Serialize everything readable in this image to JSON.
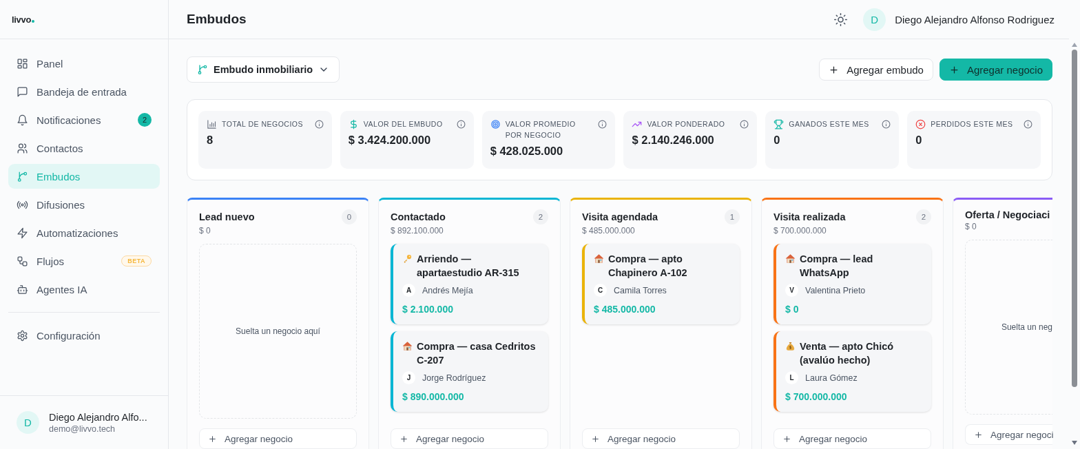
{
  "sidebar": {
    "logo": "livvo",
    "items": [
      {
        "label": "Panel",
        "selected": false
      },
      {
        "label": "Bandeja de entrada",
        "selected": false
      },
      {
        "label": "Notificaciones",
        "selected": false,
        "badge": {
          "text": "2",
          "kind": "count"
        }
      },
      {
        "label": "Contactos",
        "selected": false
      },
      {
        "label": "Embudos",
        "selected": true
      },
      {
        "label": "Difusiones",
        "selected": false
      },
      {
        "label": "Automatizaciones",
        "selected": false
      },
      {
        "label": "Flujos",
        "selected": false,
        "badge": {
          "text": "BETA",
          "kind": "beta"
        }
      },
      {
        "label": "Agentes IA",
        "selected": false
      }
    ],
    "settings": {
      "label": "Configuración",
      "selected": false
    },
    "user": {
      "initial": "D",
      "name": "Diego Alejandro Alfo...",
      "email": "demo@livvo.tech"
    }
  },
  "header": {
    "title": "Embudos",
    "user": {
      "initial": "D",
      "name": "Diego Alejandro Alfonso Rodriguez"
    }
  },
  "toolbar": {
    "pipeline": "Embudo inmobiliario",
    "buttons": [
      {
        "label": "Agregar embudo",
        "kind": "secondary"
      },
      {
        "label": "Agregar negocio",
        "kind": "primary"
      }
    ]
  },
  "stats": [
    {
      "label": "TOTAL DE NEGOCIOS",
      "value": "8"
    },
    {
      "label": "VALOR DEL EMBUDO",
      "value": "$ 3.424.200.000"
    },
    {
      "label": "VALOR PROMEDIO POR NEGOCIO",
      "value": "$ 428.025.000"
    },
    {
      "label": "VALOR PONDERADO",
      "value": "$ 2.140.246.000"
    },
    {
      "label": "GANADOS ESTE MES",
      "value": "0"
    },
    {
      "label": "PERDIDOS ESTE MES",
      "value": "0"
    }
  ],
  "stages": [
    {
      "name": "Lead nuevo",
      "count": "0",
      "total": "$ 0",
      "color": "#3b82f6",
      "empty_text": "Suelta un negocio aquí",
      "add": "Agregar negocio"
    },
    {
      "name": "Contactado",
      "count": "2",
      "total": "$ 892.100.000",
      "color": "#06b6d4",
      "add": "Agregar negocio",
      "deals": [
        {
          "kind": "rent",
          "title": "Arriendo — apartaestudio AR-315",
          "initial": "A",
          "contact": "Andrés Mejía",
          "value": "$ 2.100.000"
        },
        {
          "kind": "purchase",
          "title": "Compra — casa Cedritos C-207",
          "initial": "J",
          "contact": "Jorge Rodríguez",
          "value": "$ 890.000.000"
        }
      ]
    },
    {
      "name": "Visita agendada",
      "count": "1",
      "total": "$ 485.000.000",
      "color": "#eab308",
      "add": "Agregar negocio",
      "deals": [
        {
          "kind": "purchase",
          "title": "Compra — apto Chapinero A-102",
          "initial": "C",
          "contact": "Camila Torres",
          "value": "$ 485.000.000"
        }
      ]
    },
    {
      "name": "Visita realizada",
      "count": "2",
      "total": "$ 700.000.000",
      "color": "#f97316",
      "add": "Agregar negocio",
      "deals": [
        {
          "kind": "purchase",
          "title": "Compra — lead WhatsApp",
          "initial": "V",
          "contact": "Valentina Prieto",
          "value": "$ 0"
        },
        {
          "kind": "sale",
          "title": "Venta — apto Chicó (avalúo hecho)",
          "initial": "L",
          "contact": "Laura Gómez",
          "value": "$ 700.000.000"
        }
      ]
    },
    {
      "name": "Oferta / Negociaci",
      "total": "$ 0",
      "color": "#8b5cf6",
      "empty_text": "Suelta un neg",
      "add": "Agregar negoci"
    }
  ]
}
